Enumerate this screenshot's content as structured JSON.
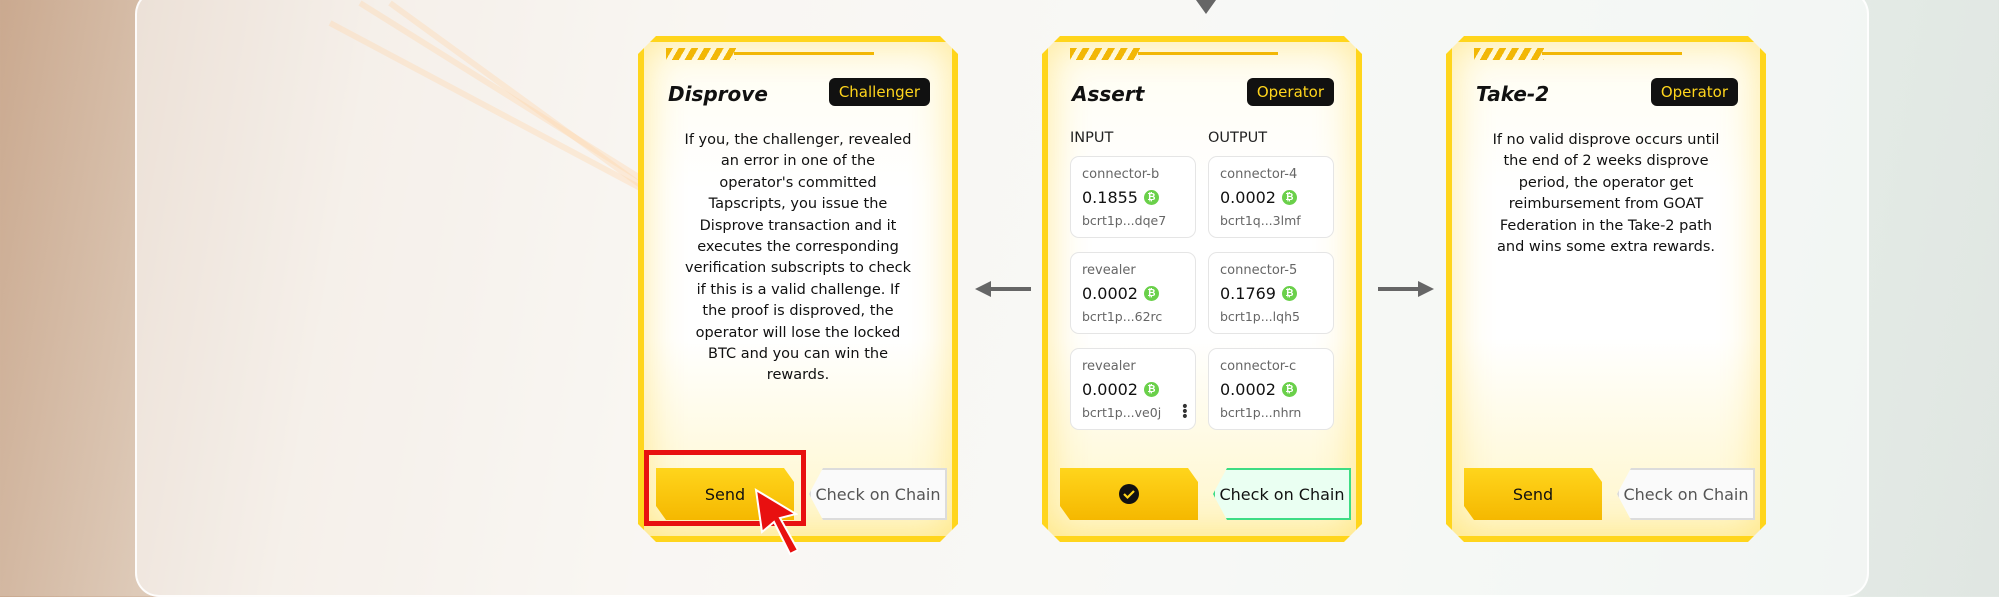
{
  "cards": {
    "disprove": {
      "title": "Disprove",
      "role": "Challenger",
      "description": "If you, the challenger, revealed an error in one of the operator's committed Tapscripts, you issue the Disprove transaction and it executes the corresponding verification subscripts to check if this is a valid challenge. If the proof is disproved, the operator will lose the locked BTC and you can win the rewards.",
      "send_label": "Send",
      "chain_label": "Check on Chain"
    },
    "assert": {
      "title": "Assert",
      "role": "Operator",
      "input_label": "INPUT",
      "output_label": "OUTPUT",
      "inputs": [
        {
          "name": "connector-b",
          "value": "0.1855",
          "addr": "bcrt1p...dqe7"
        },
        {
          "name": "revealer",
          "value": "0.0002",
          "addr": "bcrt1p...62rc"
        },
        {
          "name": "revealer",
          "value": "0.0002",
          "addr": "bcrt1p...ve0j"
        }
      ],
      "outputs": [
        {
          "name": "connector-4",
          "value": "0.0002",
          "addr": "bcrt1q...3lmf"
        },
        {
          "name": "connector-5",
          "value": "0.1769",
          "addr": "bcrt1p...lqh5"
        },
        {
          "name": "connector-c",
          "value": "0.0002",
          "addr": "bcrt1p...nhrn"
        }
      ],
      "chain_label": "Check on Chain"
    },
    "take2": {
      "title": "Take-2",
      "role": "Operator",
      "description": "If no valid disprove occurs until the end of 2 weeks disprove period, the operator get reimbursement from GOAT Federation in the Take-2 path and wins some extra rewards.",
      "send_label": "Send",
      "chain_label": "Check on Chain"
    }
  },
  "btc_symbol": "₿",
  "colors": {
    "accent": "#ffd51c",
    "role_badge_bg": "#111111",
    "btc_green": "#6ad04a",
    "chain_green": "#3ddc84",
    "highlight": "#e81010"
  }
}
